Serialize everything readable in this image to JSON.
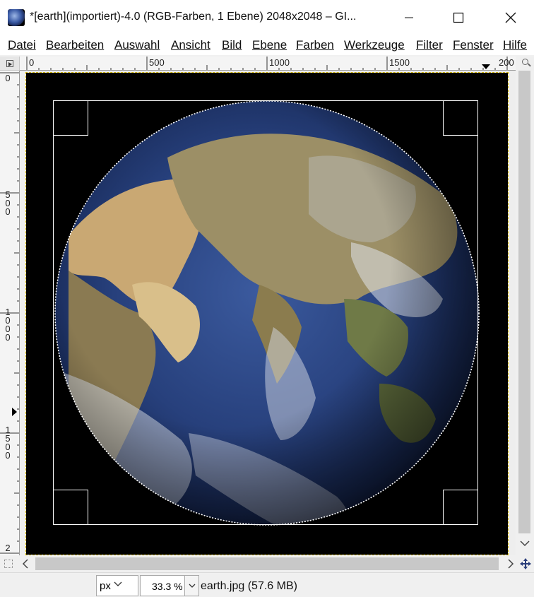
{
  "window": {
    "title": "*[earth](importiert)-4.0 (RGB-Farben, 1 Ebene) 2048x2048 – GI...",
    "icon": "gimp-image-icon"
  },
  "menu": [
    {
      "label": "Datei"
    },
    {
      "label": "Bearbeiten"
    },
    {
      "label": "Auswahl"
    },
    {
      "label": "Ansicht"
    },
    {
      "label": "Bild"
    },
    {
      "label": "Ebene"
    },
    {
      "label": "Farben"
    },
    {
      "label": "Werkzeuge"
    },
    {
      "label": "Filter"
    },
    {
      "label": "Fenster"
    },
    {
      "label": "Hilfe"
    }
  ],
  "rulers": {
    "horizontal_labels": [
      "0",
      "500",
      "1000",
      "1500",
      "200"
    ],
    "vertical_labels": [
      [
        "0"
      ],
      [
        "5",
        "0",
        "0"
      ],
      [
        "1",
        "0",
        "0",
        "0"
      ],
      [
        "1",
        "5",
        "0",
        "0"
      ],
      [
        "2"
      ]
    ]
  },
  "statusbar": {
    "unit": "px",
    "zoom": "33.3 %",
    "file_info": "earth.jpg (57.6 MB)"
  },
  "colors": {
    "selection_guide": "#ffffff",
    "image_border": "#d6b800",
    "scrollbar_thumb": "#c8c8c8"
  }
}
